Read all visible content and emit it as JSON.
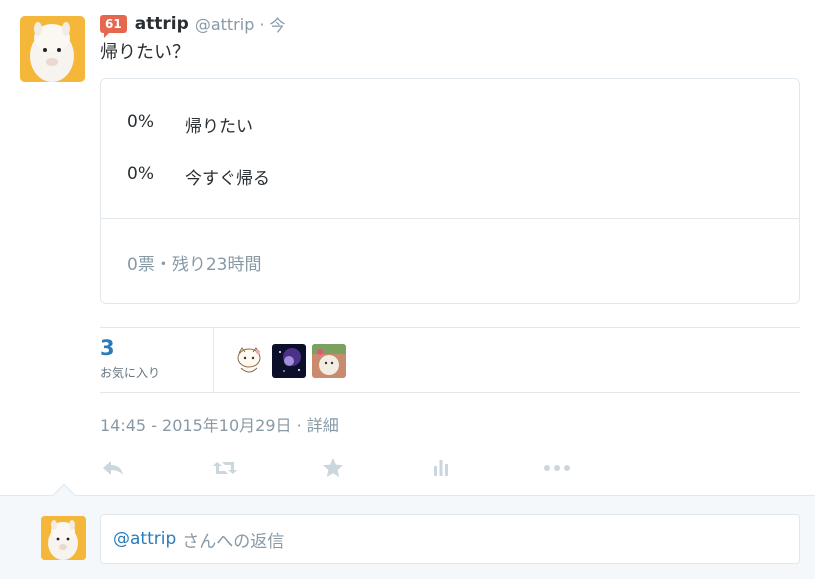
{
  "tweet": {
    "badge": "61",
    "fullname": "attrip",
    "screen_name": "@attrip",
    "separator": "·",
    "time": "今",
    "text": "帰りたい？"
  },
  "poll": {
    "choices": [
      {
        "percent": "0%",
        "label": "帰りたい"
      },
      {
        "percent": "0%",
        "label": "今すぐ帰る"
      }
    ],
    "footer": "0票・残り23時間"
  },
  "stats": {
    "favorites_count": "3",
    "favorites_label": "お気に入り"
  },
  "timestamp": {
    "datetime": "14:45 - 2015年10月29日",
    "separator": "·",
    "details": "詳細"
  },
  "actions": [
    {
      "icon": "reply-icon"
    },
    {
      "icon": "retweet-icon"
    },
    {
      "icon": "favorite-star-icon"
    },
    {
      "icon": "analytics-icon"
    },
    {
      "icon": "more-icon"
    }
  ],
  "reply": {
    "mention": "@attrip",
    "placeholder_rest": "さんへの返信"
  },
  "colors": {
    "link": "#2b7bb9",
    "muted": "#8899a6",
    "badge": "#e6674f",
    "avatar_bg": "#f4b73a"
  }
}
